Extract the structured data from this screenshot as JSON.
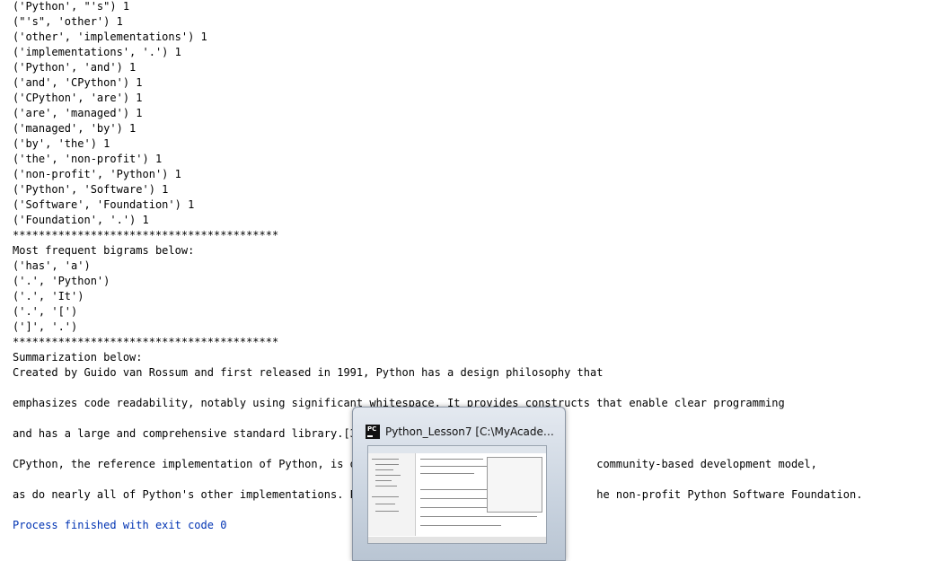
{
  "console": {
    "lines": [
      "('Python', \"'s\") 1",
      "(\"'s\", 'other') 1",
      "('other', 'implementations') 1",
      "('implementations', '.') 1",
      "('Python', 'and') 1",
      "('and', 'CPython') 1",
      "('CPython', 'are') 1",
      "('are', 'managed') 1",
      "('managed', 'by') 1",
      "('by', 'the') 1",
      "('the', 'non-profit') 1",
      "('non-profit', 'Python') 1",
      "('Python', 'Software') 1",
      "('Software', 'Foundation') 1",
      "('Foundation', '.') 1",
      "*****************************************",
      "Most frequent bigrams below:",
      "('has', 'a')",
      "('.', 'Python')",
      "('.', 'It')",
      "('.', '[')",
      "(']', '.')",
      "*****************************************",
      "Summarization below:",
      "Created by Guido van Rossum and first released in 1991, Python has a design philosophy that",
      "",
      "emphasizes code readability, notably using significant whitespace. It provides constructs that enable clear programming",
      "",
      "and has a large and comprehensive standard library.[30",
      "",
      "CPython, the reference implementation of Python, is op                                    community-based development model,",
      "",
      "as do nearly all of Python's other implementations. Py                                    he non-profit Python Software Foundation.",
      "",
      "Process finished with exit code 0"
    ]
  },
  "taskbar_thumbnail": {
    "icon": "pycharm-icon",
    "icon_text": "PC",
    "title": "Python_Lesson7 [C:\\MyAcadem..."
  },
  "colors": {
    "exit_text": "#0033b3",
    "thumbnail_bg": "#c9d3df"
  }
}
